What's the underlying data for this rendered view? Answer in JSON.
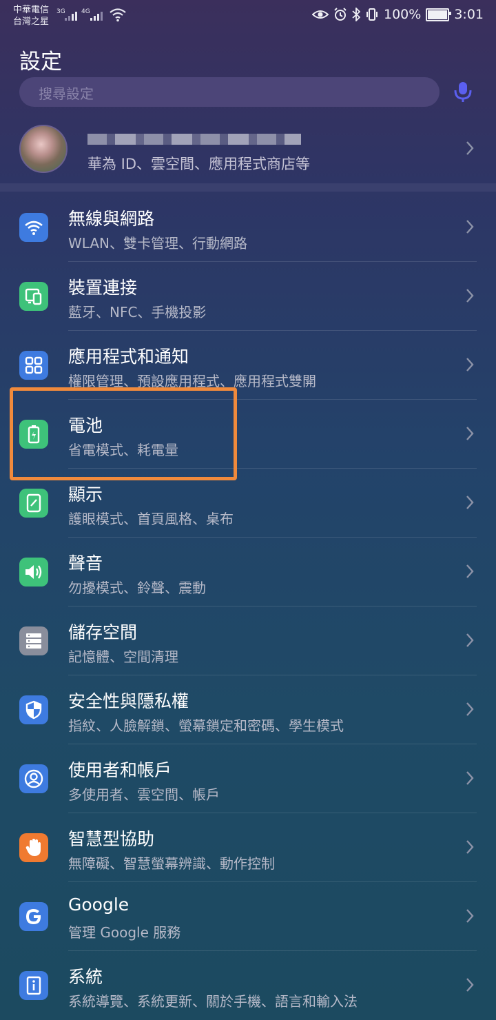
{
  "status_bar": {
    "carrier_line1": "中華電信",
    "carrier_line2": "台灣之星",
    "net1": "3G",
    "net2": "4G",
    "battery_text": "100%",
    "time": "3:01"
  },
  "page_title": "設定",
  "search": {
    "placeholder": "搜尋設定"
  },
  "account": {
    "subtitle": "華為 ID、雲空間、應用程式商店等"
  },
  "items": [
    {
      "label": "無線與網路",
      "sub": "WLAN、雙卡管理、行動網路",
      "icon": "wifi-icon",
      "color": "#3e7be0"
    },
    {
      "label": "裝置連接",
      "sub": "藍牙、NFC、手機投影",
      "icon": "device-connect-icon",
      "color": "#3ec27a"
    },
    {
      "label": "應用程式和通知",
      "sub": "權限管理、預設應用程式、應用程式雙開",
      "icon": "apps-grid-icon",
      "color": "#3e7be0"
    },
    {
      "label": "電池",
      "sub": "省電模式、耗電量",
      "icon": "battery-icon",
      "color": "#3ec27a"
    },
    {
      "label": "顯示",
      "sub": "護眼模式、首頁風格、桌布",
      "icon": "display-icon",
      "color": "#3ec27a"
    },
    {
      "label": "聲音",
      "sub": "勿擾模式、鈴聲、震動",
      "icon": "speaker-icon",
      "color": "#3ec27a"
    },
    {
      "label": "儲存空間",
      "sub": "記憶體、空間清理",
      "icon": "storage-icon",
      "color": "#8a8e9c"
    },
    {
      "label": "安全性與隱私權",
      "sub": "指紋、人臉解鎖、螢幕鎖定和密碼、學生模式",
      "icon": "shield-icon",
      "color": "#3e7be0"
    },
    {
      "label": "使用者和帳戶",
      "sub": "多使用者、雲空間、帳戶",
      "icon": "user-icon",
      "color": "#3e7be0"
    },
    {
      "label": "智慧型協助",
      "sub": "無障礙、智慧螢幕辨識、動作控制",
      "icon": "hand-icon",
      "color": "#f07a30"
    },
    {
      "label": "Google",
      "sub": "管理 Google 服務",
      "icon": "google-icon",
      "color": "#3e7be0"
    },
    {
      "label": "系統",
      "sub": "系統導覽、系統更新、關於手機、語言和輸入法",
      "icon": "info-icon",
      "color": "#3e7be0"
    }
  ],
  "colors": {
    "highlight": "#f08a3c",
    "accent_mic": "#5b5ff0"
  }
}
